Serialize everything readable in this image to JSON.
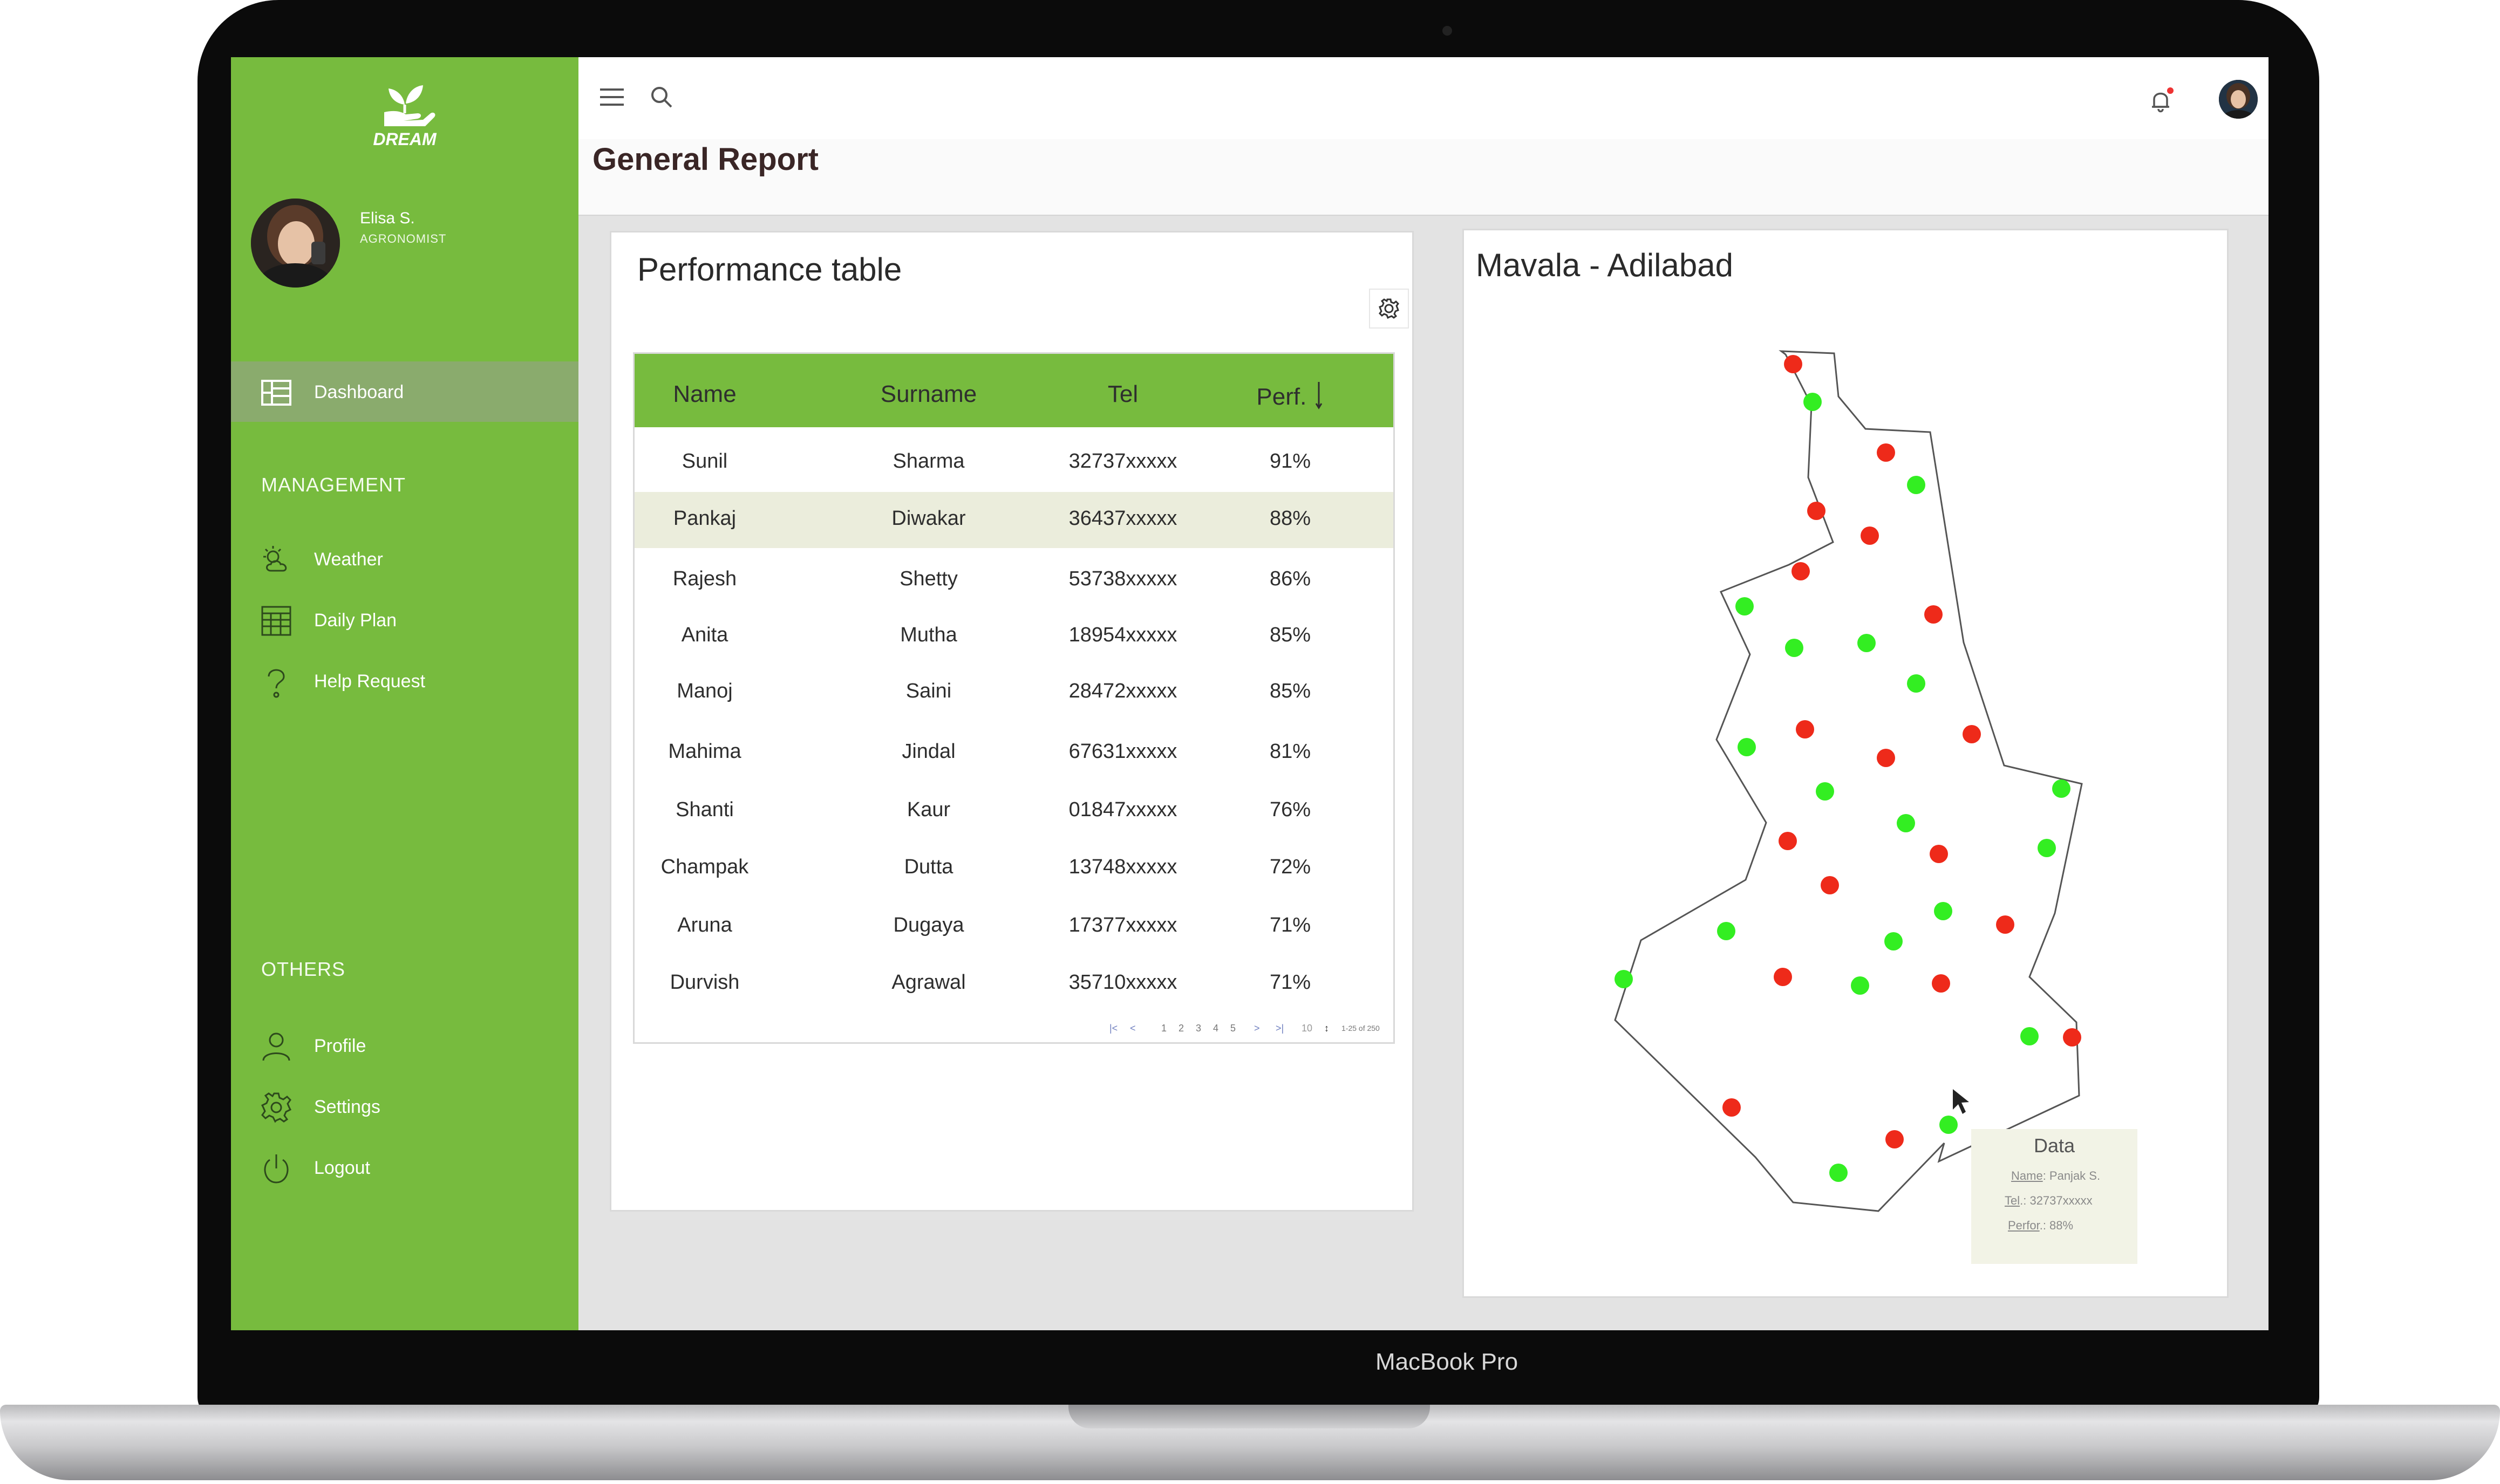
{
  "device": {
    "label": "MacBook Pro"
  },
  "app": {
    "logo_text": "DREAM",
    "page_title": "General Report"
  },
  "user": {
    "name": "Elisa S.",
    "role": "AGRONOMIST"
  },
  "sidebar": {
    "dashboard_label": "Dashboard",
    "management_heading": "MANAGEMENT",
    "management_items": [
      {
        "label": "Weather",
        "icon": "weather-icon"
      },
      {
        "label": "Daily Plan",
        "icon": "calendar-grid-icon"
      },
      {
        "label": "Help Request",
        "icon": "question-icon"
      }
    ],
    "others_heading": "OTHERS",
    "others_items": [
      {
        "label": "Profile",
        "icon": "person-icon"
      },
      {
        "label": "Settings",
        "icon": "gear-icon"
      },
      {
        "label": "Logout",
        "icon": "power-icon"
      }
    ]
  },
  "performance": {
    "title": "Performance table",
    "columns": [
      "Name",
      "Surname",
      "Tel",
      "Perf."
    ],
    "rows": [
      {
        "name": "Sunil",
        "surname": "Sharma",
        "tel": "32737xxxxx",
        "perf": "91%"
      },
      {
        "name": "Pankaj",
        "surname": "Diwakar",
        "tel": "36437xxxxx",
        "perf": "88%"
      },
      {
        "name": "Rajesh",
        "surname": "Shetty",
        "tel": "53738xxxxx",
        "perf": "86%"
      },
      {
        "name": "Anita",
        "surname": "Mutha",
        "tel": "18954xxxxx",
        "perf": "85%"
      },
      {
        "name": "Manoj",
        "surname": "Saini",
        "tel": "28472xxxxx",
        "perf": "85%"
      },
      {
        "name": "Mahima",
        "surname": "Jindal",
        "tel": "67631xxxxx",
        "perf": "81%"
      },
      {
        "name": "Shanti",
        "surname": "Kaur",
        "tel": "01847xxxxx",
        "perf": "76%"
      },
      {
        "name": "Champak",
        "surname": "Dutta",
        "tel": "13748xxxxx",
        "perf": "72%"
      },
      {
        "name": "Aruna",
        "surname": "Dugaya",
        "tel": "17377xxxxx",
        "perf": "71%"
      },
      {
        "name": "Durvish",
        "surname": "Agrawal",
        "tel": "35710xxxxx",
        "perf": "71%"
      }
    ],
    "selected_row": 1,
    "pager": {
      "pages": [
        "1",
        "2",
        "3",
        "4",
        "5"
      ],
      "per_page": "10",
      "range": "1-25 of 250"
    }
  },
  "map": {
    "title": "Mavala - Adilabad",
    "colors": {
      "high": "#33ee22",
      "low": "#ee2a1a",
      "outline": "#555555"
    },
    "tooltip": {
      "title": "Data",
      "name_label": "Name",
      "name_value": ": Panjak S.",
      "tel_label": "Tel",
      "tel_value": ".: 32737xxxxx",
      "perf_label": "Perfor",
      "perf_value": ".: 88%"
    }
  }
}
